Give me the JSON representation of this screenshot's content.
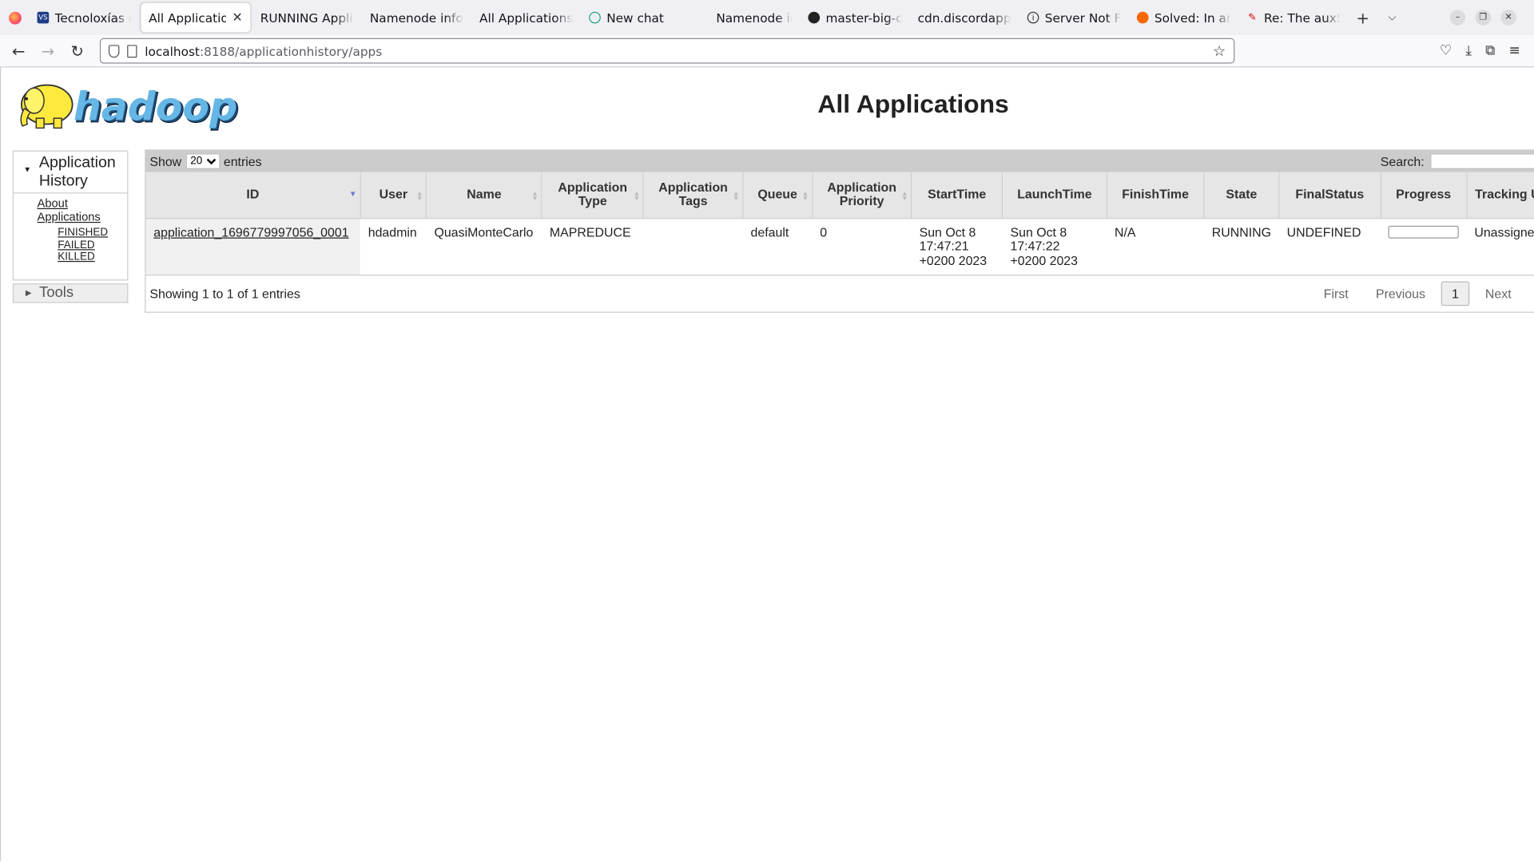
{
  "browser": {
    "tabs": [
      {
        "title": "Tecnoloxías de",
        "icon": "vs-icon",
        "active": false
      },
      {
        "title": "All Applications",
        "icon": "",
        "active": true
      },
      {
        "title": "RUNNING Applica",
        "icon": "",
        "active": false
      },
      {
        "title": "Namenode inform",
        "icon": "",
        "active": false
      },
      {
        "title": "All Applications",
        "icon": "",
        "active": false
      },
      {
        "title": "New chat",
        "icon": "chatgpt-icon",
        "active": false
      },
      {
        "title": "Namenode inform",
        "icon": "",
        "active": false
      },
      {
        "title": "master-big-dat",
        "icon": "github-icon",
        "active": false
      },
      {
        "title": "cdn.discordapp.co",
        "icon": "",
        "active": false
      },
      {
        "title": "Server Not Fou",
        "icon": "info-icon",
        "active": false
      },
      {
        "title": "Solved: In amb",
        "icon": "cloudera-icon",
        "active": false
      },
      {
        "title": "Re: The auxSer",
        "icon": "pen-icon",
        "active": false
      }
    ],
    "url_host": "localhost",
    "url_path": ":8188/applicationhistory/apps"
  },
  "page": {
    "title": "All Applications",
    "logo_text": "hadoop"
  },
  "sidebar": {
    "section_title": "Application History",
    "about": "About",
    "applications": "Applications",
    "states": [
      "FINISHED",
      "FAILED",
      "KILLED"
    ],
    "tools": "Tools"
  },
  "table": {
    "show_label": "Show",
    "entries_value": "20",
    "entries_label": "entries",
    "search_label": "Search:",
    "columns": [
      "ID",
      "User",
      "Name",
      "Application Type",
      "Application Tags",
      "Queue",
      "Application Priority",
      "StartTime",
      "LaunchTime",
      "FinishTime",
      "State",
      "FinalStatus",
      "Progress",
      "Tracking UI"
    ],
    "rows": [
      {
        "id": "application_1696779997056_0001",
        "user": "hdadmin",
        "name": "QuasiMonteCarlo",
        "type": "MAPREDUCE",
        "tags": "",
        "queue": "default",
        "priority": "0",
        "start": "Sun Oct 8 17:47:21 +0200 2023",
        "launch": "Sun Oct 8 17:47:22 +0200 2023",
        "finish": "N/A",
        "state": "RUNNING",
        "final_status": "UNDEFINED",
        "progress": 0,
        "tracking": "Unassigned"
      }
    ],
    "info": "Showing 1 to 1 of 1 entries",
    "pager": {
      "first": "First",
      "previous": "Previous",
      "page": "1",
      "next": "Next"
    }
  }
}
